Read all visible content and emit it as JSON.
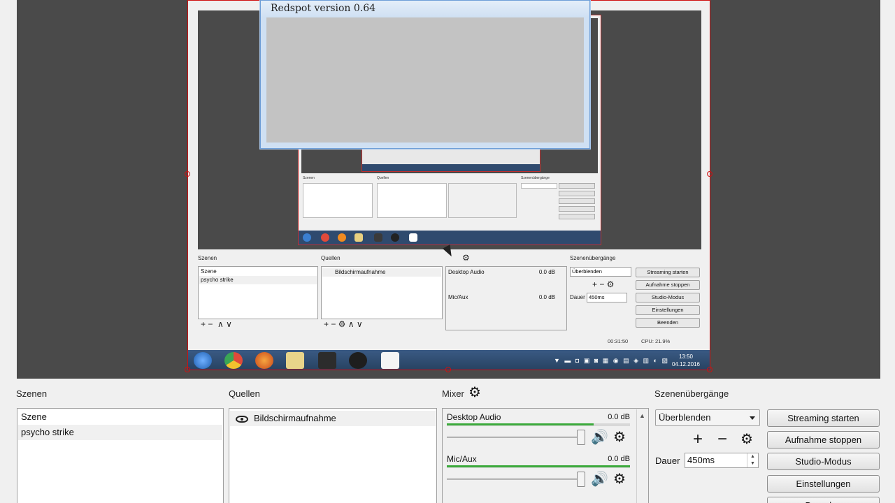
{
  "preview": {
    "captured_screen": {
      "docks": {
        "scenes_title": "Szenen",
        "sources_title": "Quellen",
        "transitions_title": "Szenenübergänge",
        "scenes": [
          "Szene",
          "psycho strike"
        ],
        "source": "Bildschirmaufnahme",
        "mixer": [
          {
            "name": "Desktop Audio",
            "db": "0.0 dB"
          },
          {
            "name": "Mic/Aux",
            "db": "0.0 dB"
          }
        ],
        "transition": "Überblenden",
        "duration_label": "Dauer",
        "duration_value": "450ms",
        "buttons": [
          "Streaming starten",
          "Aufnahme stoppen",
          "Studio-Modus",
          "Einstellungen",
          "Beenden"
        ],
        "status_time": "00:31:50",
        "status_cpu": "CPU: 21.9%"
      },
      "taskbar": {
        "clock_time": "13:50",
        "clock_date": "04.12.2016"
      }
    },
    "redspot_window": {
      "title": "Redspot version 0.64"
    }
  },
  "docks": {
    "scenes": {
      "title": "Szenen",
      "items": [
        {
          "label": "Szene"
        },
        {
          "label": "psycho strike"
        }
      ]
    },
    "sources": {
      "title": "Quellen",
      "items": [
        {
          "label": "Bildschirmaufnahme",
          "icon": "eye-icon"
        }
      ]
    },
    "mixer": {
      "title": "Mixer",
      "channels": [
        {
          "name": "Desktop Audio",
          "db": "0.0 dB",
          "level": 0.8
        },
        {
          "name": "Mic/Aux",
          "db": "0.0 dB",
          "level": 1.0
        }
      ]
    },
    "transitions": {
      "title": "Szenenübergänge",
      "selected": "Überblenden",
      "duration_label": "Dauer",
      "duration_value": "450ms"
    },
    "controls": {
      "buttons": [
        "Streaming starten",
        "Aufnahme stoppen",
        "Studio-Modus",
        "Einstellungen",
        "Beenden"
      ]
    }
  },
  "colors": {
    "selection_border": "#d01010",
    "meter_green": "#3caa3c",
    "preview_bg": "#4a4a4a"
  }
}
